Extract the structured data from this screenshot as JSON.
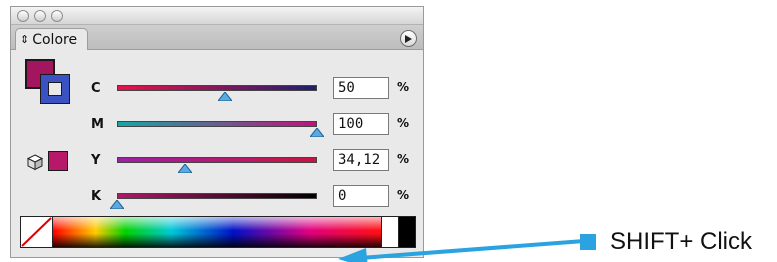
{
  "panel": {
    "tab_label": "Colore",
    "fill_color": "#a3155f",
    "stroke_color": "#3b53c2",
    "out_of_gamut_color": "#b8186a"
  },
  "sliders": [
    {
      "label": "C",
      "value": "50",
      "unit": "%",
      "thumb_fraction": 0.54,
      "gradient": [
        "#e8104a",
        "#1f1f6e"
      ]
    },
    {
      "label": "M",
      "value": "100",
      "unit": "%",
      "thumb_fraction": 1.0,
      "gradient": [
        "#14a7a7",
        "#c0127c"
      ]
    },
    {
      "label": "Y",
      "value": "34,12",
      "unit": "%",
      "thumb_fraction": 0.34,
      "gradient": [
        "#9c1fa6",
        "#c81440"
      ]
    },
    {
      "label": "K",
      "value": "0",
      "unit": "%",
      "thumb_fraction": 0.0,
      "gradient": [
        "#b0176a",
        "#000000"
      ]
    }
  ],
  "annotation": {
    "text": "SHIFT+ Click",
    "color": "#2aa3e0"
  }
}
